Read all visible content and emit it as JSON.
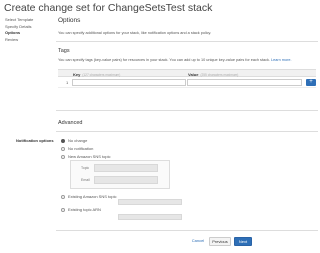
{
  "page": {
    "title": "Create change set for ChangeSetsTest stack"
  },
  "sidebar": {
    "items": [
      {
        "label": "Select Template",
        "active": false
      },
      {
        "label": "Specify Details",
        "active": false
      },
      {
        "label": "Options",
        "active": true
      },
      {
        "label": "Review",
        "active": false
      }
    ]
  },
  "options": {
    "heading": "Options",
    "description": "You can specify additional options for your stack, like notification options and a stack policy."
  },
  "tags": {
    "heading": "Tags",
    "description": "You can specify tags (key-value pairs) for resources in your stack. You can add up to 10 unique key-value pairs for each stack.",
    "learn_more": "Learn more.",
    "columns": {
      "key": "Key",
      "key_hint": "(127 characters maximum)",
      "value": "Value",
      "value_hint": "(255 characters maximum)"
    },
    "rows": [
      {
        "num": "1",
        "key": "",
        "value": ""
      }
    ],
    "add_icon": "plus-icon"
  },
  "advanced": {
    "heading": "Advanced",
    "notification_label": "Notification options",
    "options": [
      {
        "label": "No change",
        "selected": true
      },
      {
        "label": "No notification",
        "selected": false
      },
      {
        "label": "New Amazon SNS topic",
        "selected": false
      },
      {
        "label": "Existing Amazon SNS topic",
        "selected": false
      },
      {
        "label": "Existing topic ARN",
        "selected": false
      }
    ],
    "sns_fields": {
      "topic_label": "Topic",
      "email_label": "Email"
    }
  },
  "footer": {
    "cancel": "Cancel",
    "previous": "Previous",
    "next": "Next"
  }
}
